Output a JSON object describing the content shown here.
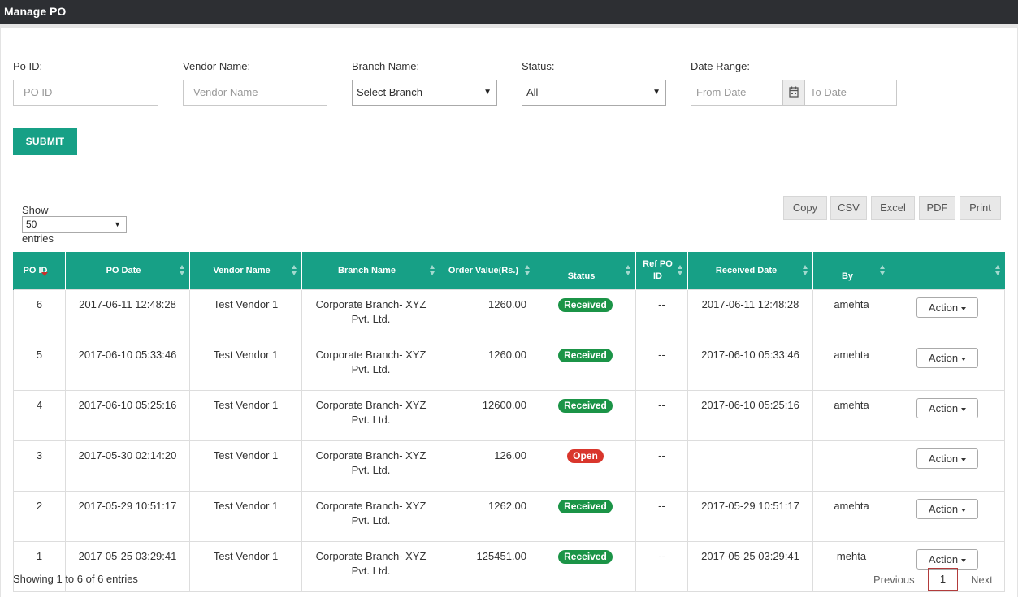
{
  "header": {
    "title": "Manage PO"
  },
  "filters": {
    "po_id": {
      "label": "Po ID:",
      "placeholder": "PO ID"
    },
    "vendor": {
      "label": "Vendor Name:",
      "placeholder": "Vendor Name"
    },
    "branch": {
      "label": "Branch Name:",
      "selected": "Select Branch"
    },
    "status": {
      "label": "Status:",
      "selected": "All"
    },
    "date_range": {
      "label": "Date Range:",
      "from_placeholder": "From Date",
      "to_placeholder": "To Date"
    },
    "submit_label": "SUBMIT"
  },
  "length": {
    "show_label": "Show",
    "selected": "50",
    "entries_label": "entries"
  },
  "export_buttons": [
    "Copy",
    "CSV",
    "Excel",
    "PDF",
    "Print"
  ],
  "table": {
    "columns": [
      "PO ID",
      "PO Date",
      "Vendor Name",
      "Branch Name",
      "Order Value(Rs.)",
      "Status",
      "Ref PO ID",
      "Received Date",
      "By",
      ""
    ],
    "action_label": "Action",
    "rows": [
      {
        "po_id": "6",
        "po_date": "2017-06-11 12:48:28",
        "vendor": "Test Vendor 1",
        "branch": "Corporate Branch- XYZ Pvt. Ltd.",
        "value": "1260.00",
        "status": "Received",
        "ref": "--",
        "received_date": "2017-06-11 12:48:28",
        "by": "amehta"
      },
      {
        "po_id": "5",
        "po_date": "2017-06-10 05:33:46",
        "vendor": "Test Vendor 1",
        "branch": "Corporate Branch- XYZ Pvt. Ltd.",
        "value": "1260.00",
        "status": "Received",
        "ref": "--",
        "received_date": "2017-06-10 05:33:46",
        "by": "amehta"
      },
      {
        "po_id": "4",
        "po_date": "2017-06-10 05:25:16",
        "vendor": "Test Vendor 1",
        "branch": "Corporate Branch- XYZ Pvt. Ltd.",
        "value": "12600.00",
        "status": "Received",
        "ref": "--",
        "received_date": "2017-06-10 05:25:16",
        "by": "amehta"
      },
      {
        "po_id": "3",
        "po_date": "2017-05-30 02:14:20",
        "vendor": "Test Vendor 1",
        "branch": "Corporate Branch- XYZ Pvt. Ltd.",
        "value": "126.00",
        "status": "Open",
        "ref": "--",
        "received_date": "",
        "by": ""
      },
      {
        "po_id": "2",
        "po_date": "2017-05-29 10:51:17",
        "vendor": "Test Vendor 1",
        "branch": "Corporate Branch- XYZ Pvt. Ltd.",
        "value": "1262.00",
        "status": "Received",
        "ref": "--",
        "received_date": "2017-05-29 10:51:17",
        "by": "amehta"
      },
      {
        "po_id": "1",
        "po_date": "2017-05-25 03:29:41",
        "vendor": "Test Vendor 1",
        "branch": "Corporate Branch- XYZ Pvt. Ltd.",
        "value": "125451.00",
        "status": "Received",
        "ref": "--",
        "received_date": "2017-05-25 03:29:41",
        "by": "mehta"
      }
    ]
  },
  "footer": {
    "info": "Showing 1 to 6 of 6 entries",
    "previous": "Previous",
    "current_page": "1",
    "next": "Next"
  },
  "colors": {
    "accent": "#17a086",
    "received": "#1b9447",
    "open": "#d9362c",
    "topbar": "#2d2f33"
  },
  "icons": {
    "calendar": "calendar-icon",
    "sort": "sort-icon",
    "dropdown": "caret-down-icon"
  }
}
